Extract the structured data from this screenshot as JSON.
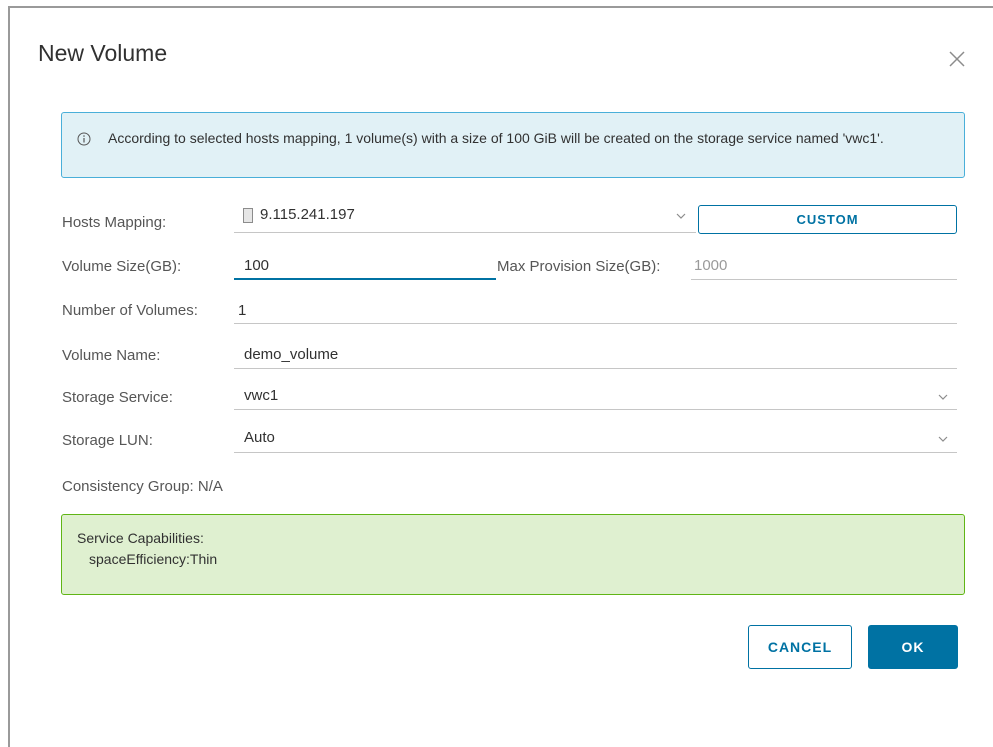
{
  "dialog": {
    "title": "New Volume",
    "close_icon": "close-icon"
  },
  "info": {
    "icon": "info-icon",
    "message": "According to selected hosts mapping, 1 volume(s) with a size of 100 GiB will be created on the storage service named 'vwc1'."
  },
  "form": {
    "hosts_mapping": {
      "label": "Hosts Mapping:",
      "value": "9.115.241.197",
      "custom_label": "CUSTOM"
    },
    "volume_size": {
      "label": "Volume Size(GB):",
      "value": "100"
    },
    "max_provision": {
      "label": "Max Provision Size(GB):",
      "placeholder": "1000"
    },
    "number_of_volumes": {
      "label": "Number of Volumes:",
      "value": "1"
    },
    "volume_name": {
      "label": "Volume Name:",
      "value": "demo_volume"
    },
    "storage_service": {
      "label": "Storage Service:",
      "value": "vwc1"
    },
    "storage_lun": {
      "label": "Storage LUN:",
      "value": "Auto"
    },
    "consistency_group": {
      "label": "Consistency Group:",
      "value": "N/A"
    }
  },
  "capabilities": {
    "title": "Service Capabilities:",
    "items": [
      "spaceEfficiency:Thin"
    ]
  },
  "buttons": {
    "cancel": "CANCEL",
    "ok": "OK"
  },
  "colors": {
    "accent": "#0072a3",
    "info_bg": "#e1f1f6",
    "info_border": "#49afd9",
    "success_bg": "#dff0d0",
    "success_border": "#60b515",
    "active_underline": "#0072a3"
  }
}
